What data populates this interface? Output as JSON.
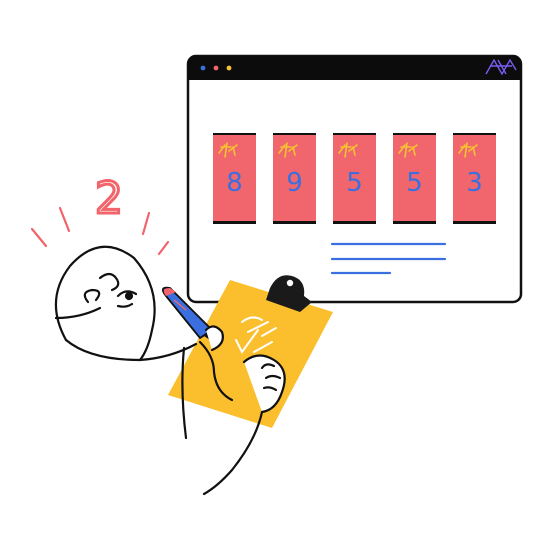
{
  "colors": {
    "ink": "#111111",
    "card": "#f0666c",
    "accent_yellow": "#f4c232",
    "clipboard": "#fbbe2d",
    "clip": "#1a1a1a",
    "pen": "#3b6fe0",
    "pen_tip": "#f2636a",
    "line_blue": "#3b6fe0",
    "window_bar": "#0c0c0c",
    "dot_blue": "#3b6fe0",
    "dot_red": "#f2636a",
    "dot_yellow": "#f4c232",
    "accent_purple": "#7a5cf0",
    "alarm_lines": "#f2636a"
  },
  "window": {
    "bar_dots": [
      "dot-blue",
      "dot-red",
      "dot-yellow"
    ],
    "corner_icon": "scribble-icon"
  },
  "cards": [
    {
      "digit": "8",
      "icon": "sparkle-icon"
    },
    {
      "digit": "9",
      "icon": "sparkle-icon"
    },
    {
      "digit": "5",
      "icon": "sparkle-icon"
    },
    {
      "digit": "5",
      "icon": "sparkle-icon"
    },
    {
      "digit": "3",
      "icon": "sparkle-icon"
    }
  ],
  "floating_text": "2",
  "clipboard": {
    "icon": "checklist-icon"
  }
}
